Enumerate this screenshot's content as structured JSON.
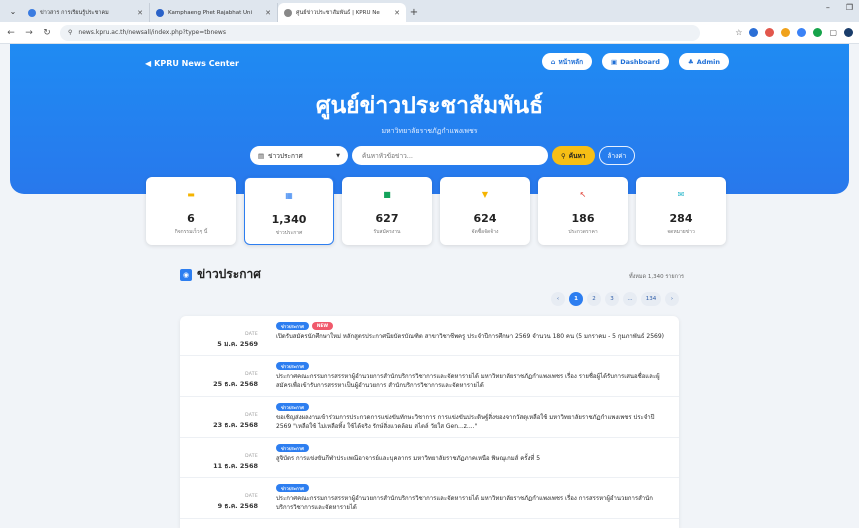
{
  "browser": {
    "tabs": [
      {
        "title": "ข่าวสาร การเรียนรู้ประชาคม",
        "color": "#3a7be0",
        "active": false
      },
      {
        "title": "Kamphaeng Phet Rajabhat Uni",
        "color": "#2a62c8",
        "active": false
      },
      {
        "title": "ศูนย์ข่าวประชาสัมพันธ์ | KPRU Ne",
        "color": "#888888",
        "active": true
      }
    ],
    "url": "news.kpru.ac.th/newsall/index.php?type=tbnews"
  },
  "header": {
    "brand": "KPRU News Center",
    "buttons": [
      {
        "label": "หน้าหลัก",
        "icon": "home-icon"
      },
      {
        "label": "Dashboard",
        "icon": "dashboard-icon"
      },
      {
        "label": "Admin",
        "icon": "users-icon"
      }
    ],
    "title": "ศูนย์ข่าวประชาสัมพันธ์",
    "subtitle": "มหาวิทยาลัยราชภัฏกำแพงเพชร"
  },
  "search": {
    "category": "ข่าวประกาศ",
    "placeholder": "ค้นหาหัวข้อข่าว...",
    "search_label": "ค้นหา",
    "clear_label": "ล้างค่า"
  },
  "stats": [
    {
      "num": "6",
      "label": "กิจกรรมเร็วๆ นี้",
      "color": "#f5b400",
      "glyph": "▬"
    },
    {
      "num": "1,340",
      "label": "ข่าวประกาศ",
      "color": "#2d7ef0",
      "glyph": "▦"
    },
    {
      "num": "627",
      "label": "รับสมัครงาน",
      "color": "#14a35b",
      "glyph": "■"
    },
    {
      "num": "624",
      "label": "จัดซื้อจัดจ้าง",
      "color": "#f5b400",
      "glyph": "▼"
    },
    {
      "num": "186",
      "label": "ประกวดราคา",
      "color": "#e03c31",
      "glyph": "↖"
    },
    {
      "num": "284",
      "label": "จดหมายข่าว",
      "color": "#24b5c9",
      "glyph": "✉"
    }
  ],
  "section": {
    "title": "ข่าวประกาศ",
    "total": "ทั้งหมด 1,340 รายการ"
  },
  "pagination": {
    "prev": "‹",
    "pages": [
      "1",
      "2",
      "3"
    ],
    "ellipsis": "...",
    "last": "134",
    "next": "›"
  },
  "news": [
    {
      "date_label": "DATE",
      "date": "5 ม.ค. 2569",
      "badge": "ข่าวประกาศ",
      "new": "NEW",
      "text": "เปิดรับสมัครนักศึกษาใหม่ หลักสูตรประกาศนียบัตรบัณฑิต สาขาวิชาชีพครู ประจำปีการศึกษา 2569 จำนวน 180 คน (5 มกราคม - 5 กุมภาพันธ์ 2569)"
    },
    {
      "date_label": "DATE",
      "date": "25 ธ.ค. 2568",
      "badge": "ข่าวประกาศ",
      "new": "",
      "text": "ประกาศคณะกรรมการสรรหาผู้อำนวยการสำนักบริการวิชาการและจัดหารายได้ มหาวิทยาลัยราชภัฏกำแพงเพชร เรื่อง รายชื่อผู้ได้รับการเสนอชื่อและผู้สมัครเพื่อเข้ารับการสรรหาเป็นผู้อำนวยการ สำนักบริการวิชาการและจัดหารายได้"
    },
    {
      "date_label": "DATE",
      "date": "23 ธ.ค. 2568",
      "badge": "ข่าวประกาศ",
      "new": "",
      "text": "ขอเชิญส่งผลงานเข้าร่วมการประกวดการแข่งขันทักษะวิชาการ การแข่งขันประดิษฐ์สิ่งของจากวัสดุเหลือใช้ มหาวิทยาลัยราชภัฏกำแพงเพชร ประจำปี 2569 \"เหลือใช้ ไม่เหลือทิ้ง ใช้ได้จริง รักษ์สิ่งแวดล้อม สไตล์ วัยใส Gen...z....\""
    },
    {
      "date_label": "DATE",
      "date": "11 ธ.ค. 2568",
      "badge": "ข่าวประกาศ",
      "new": "",
      "text": "สูจิบัตร การแข่งขันกีฬาประเพณีอาจารย์และบุคลากร มหาวิทยาลัยราชภัฏภาคเหนือ พิษณุเกมส์ ครั้งที่ 5"
    },
    {
      "date_label": "DATE",
      "date": "9 ธ.ค. 2568",
      "badge": "ข่าวประกาศ",
      "new": "",
      "text": "ประกาศคณะกรรมการสรรหาผู้อำนวยการสำนักบริการวิชาการและจัดหารายได้ มหาวิทยาลัยราชภัฏกำแพงเพชร เรื่อง การสรรหาผู้อำนวยการสำนักบริการวิชาการและจัดหารายได้"
    }
  ]
}
